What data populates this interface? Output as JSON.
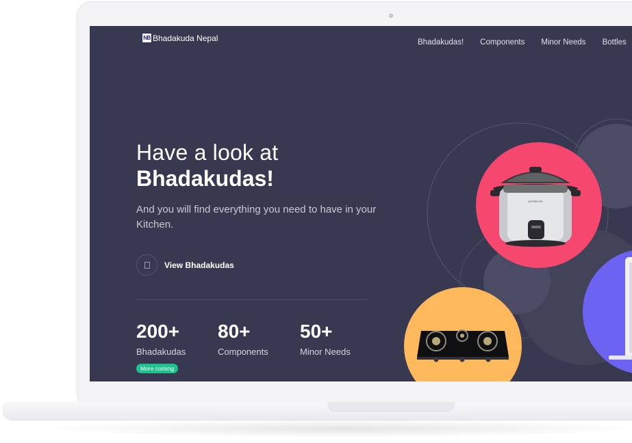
{
  "brand": {
    "logo_text": "NB",
    "name": "Bhadakuda Nepal"
  },
  "nav": {
    "items": [
      "Bhadakudas!",
      "Components",
      "Minor Needs",
      "Bottles"
    ]
  },
  "hero": {
    "line1": "Have a look at",
    "line2": "Bhadakudas!",
    "subtitle": "And you will find everything you need to have in your Kitchen.",
    "cta_label": "View Bhadakudas"
  },
  "stats": [
    {
      "value": "200+",
      "label": "Bhadakudas"
    },
    {
      "value": "80+",
      "label": "Components"
    },
    {
      "value": "50+",
      "label": "Minor Needs"
    }
  ],
  "badge": "More coming",
  "product_brand_text": "KAPMBCKE",
  "icons": {
    "cta": "book-icon",
    "products": [
      "rice-cooker-icon",
      "gas-stove-icon",
      "laptop-icon"
    ]
  },
  "colors": {
    "screen_bg": "#383850",
    "accent_pink": "#f6476f",
    "accent_yellow": "#fdb95c",
    "accent_purple": "#6c63f3",
    "badge_green": "#1dc28c"
  }
}
